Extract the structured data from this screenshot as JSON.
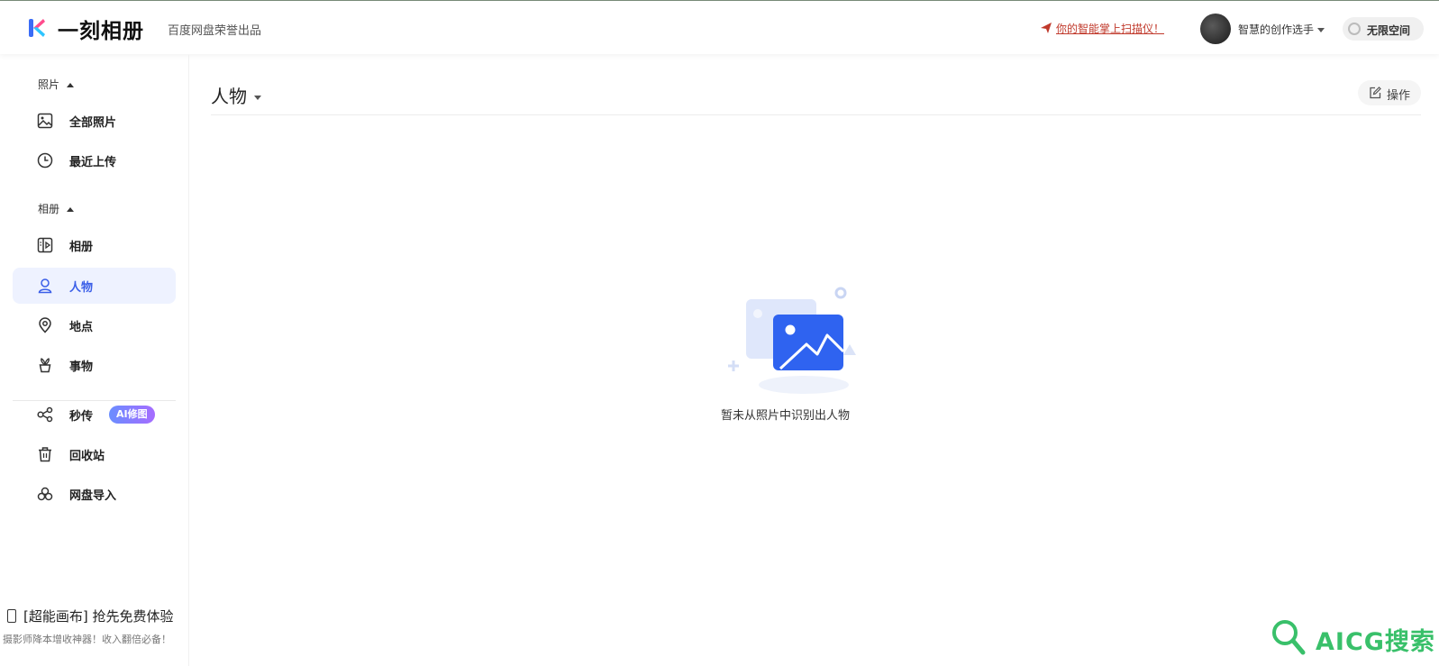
{
  "header": {
    "brand": "一刻相册",
    "subbrand": "百度网盘荣誉出品",
    "promo": "你的智能掌上扫描仪！",
    "username": "智慧的创作选手",
    "space": "无限空间"
  },
  "sidebar": {
    "photos_section": "照片",
    "albums_section": "相册",
    "items": [
      {
        "label": "全部照片",
        "icon": "image-icon"
      },
      {
        "label": "最近上传",
        "icon": "clock-icon"
      },
      {
        "label": "相册",
        "icon": "album-icon"
      },
      {
        "label": "人物",
        "icon": "person-icon",
        "active": true
      },
      {
        "label": "地点",
        "icon": "location-pin-icon"
      },
      {
        "label": "事物",
        "icon": "plant-icon"
      },
      {
        "label": "秒传",
        "icon": "share-nodes-icon",
        "badge": "AI修图"
      },
      {
        "label": "回收站",
        "icon": "trash-icon"
      },
      {
        "label": "网盘导入",
        "icon": "cloud-import-icon"
      }
    ],
    "bottom_promo": "[超能画布] 抢先免费体验",
    "bottom_sub": "摄影师降本增收神器！收入翻倍必备！"
  },
  "main": {
    "title": "人物",
    "operate": "操作",
    "empty_text": "暂未从照片中识别出人物"
  },
  "watermark": "AICG搜索",
  "colors": {
    "accent": "#3a5ee8",
    "active_bg": "#eef2ff",
    "promo_red": "#c0392b",
    "watermark_green": "#39c06a"
  }
}
